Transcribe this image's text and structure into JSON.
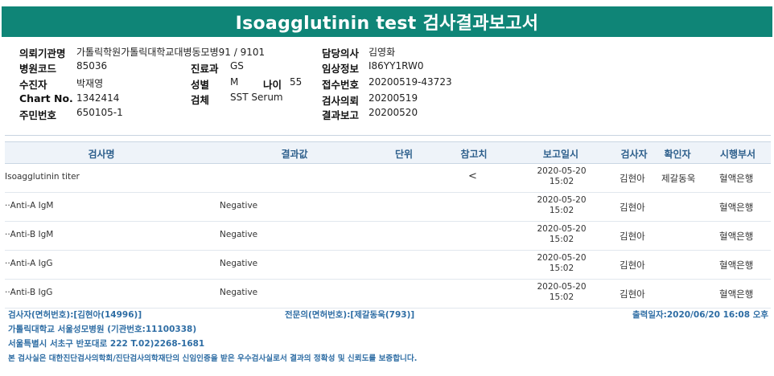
{
  "title": "Isoagglutinin test 검사결과보고서",
  "info": {
    "institution_label": "의뢰기관명",
    "institution": "가톨릭학원가톨릭대학교대병동모병91 / 9101",
    "hospital_code_label": "병원코드",
    "hospital_code": "85036",
    "patient_label": "수진자",
    "patient": "박재영",
    "chart_label": "Chart No.",
    "chart": "1342414",
    "resident_label": "주민번호",
    "resident": "650105-1",
    "department_label": "진료과",
    "department": "GS",
    "sex_label": "성별",
    "sex": "M",
    "age_label": "나이",
    "age": "55",
    "specimen_label": "검체",
    "specimen": "SST Serum",
    "doctor_label": "담당의사",
    "doctor": "김영화",
    "clinical_label": "임상정보",
    "clinical": "I86YY1RW0",
    "receipt_label": "접수번호",
    "receipt": "20200519-43723",
    "request_label": "검사의뢰",
    "request": "20200519",
    "report_label": "결과보고",
    "report": "20200520"
  },
  "table": {
    "headers": [
      "검사명",
      "결과값",
      "단위",
      "참고치",
      "보고일시",
      "검사자",
      "확인자",
      "시행부서"
    ],
    "rows": [
      {
        "name": "Isoagglutinin titer",
        "result": "",
        "ref": "<",
        "date": "2020-05-20",
        "time": "15:02",
        "tester": "김현아",
        "confirmer": "제갈동욱",
        "dept": "혈액은행"
      },
      {
        "name": "··Anti-A IgM",
        "result": "Negative",
        "ref": "",
        "date": "2020-05-20",
        "time": "15:02",
        "tester": "김현아",
        "confirmer": "",
        "dept": "혈액은행"
      },
      {
        "name": "··Anti-B IgM",
        "result": "Negative",
        "ref": "",
        "date": "2020-05-20",
        "time": "15:02",
        "tester": "김현아",
        "confirmer": "",
        "dept": "혈액은행"
      },
      {
        "name": "··Anti-A IgG",
        "result": "Negative",
        "ref": "",
        "date": "2020-05-20",
        "time": "15:02",
        "tester": "김현아",
        "confirmer": "",
        "dept": "혈액은행"
      },
      {
        "name": "··Anti-B IgG",
        "result": "Negative",
        "ref": "",
        "date": "2020-05-20",
        "time": "15:02",
        "tester": "김현아",
        "confirmer": "",
        "dept": "혈액은행"
      }
    ]
  },
  "footer": {
    "tester": "검사자(면허번호):[김현아(14996)]",
    "specialist": "전문의(면허번호):[제갈동욱(793)]",
    "printed": "출력일자:2020/06/20 16:08 오후",
    "institution": "가톨릭대학교 서울성모병원 (기관번호:11100338)",
    "address": "서울특별시 서초구 반포대로 222 T.02)2268-1681",
    "certification": "본 검사실은 대한진단검사의학회/진단검사의학재단의 신임인증을 받은 우수검사실로서 결과의 정확성 및 신뢰도를 보증합니다."
  },
  "colors": {
    "header_bg": "#0f8577",
    "accent_text": "#2e6da4"
  }
}
